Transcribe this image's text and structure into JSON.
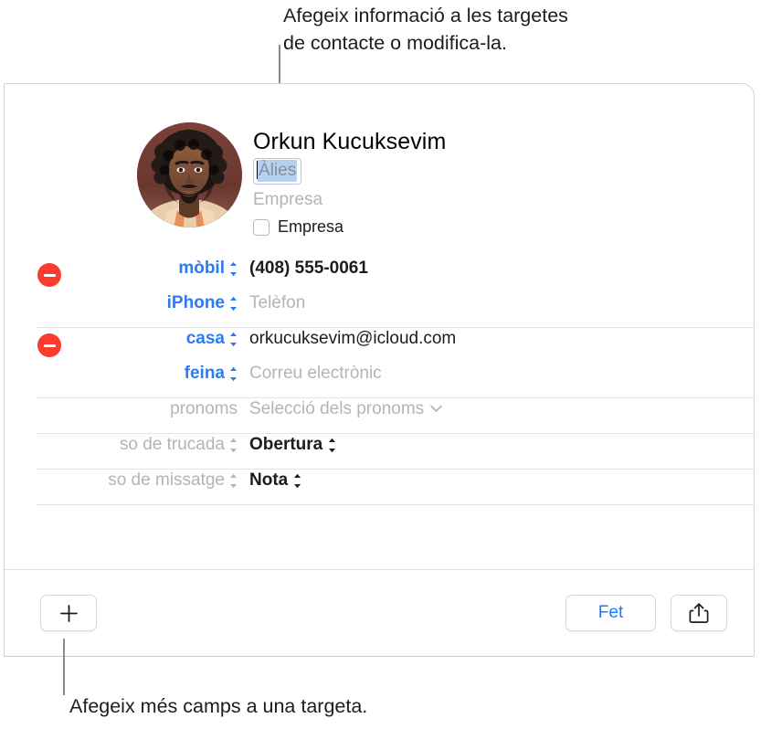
{
  "callouts": {
    "top": {
      "line1": "Afegeix informació a les targetes",
      "line2": "de contacte o modifica-la."
    },
    "bottom": {
      "line1": "Afegeix més camps a una targeta."
    }
  },
  "card": {
    "header": {
      "full_name": "Orkun  Kucuksevim",
      "nickname_value": "Àlies",
      "company_placeholder": "Empresa",
      "company_checkbox_label": "Empresa",
      "company_checkbox_checked": false
    },
    "fields": [
      {
        "label": "mòbil",
        "label_style": "blue",
        "value": "(408) 555-0061",
        "value_style": "bold",
        "has_remove": true,
        "has_stepper": true
      },
      {
        "label": "iPhone",
        "label_style": "blue",
        "value": "Telèfon",
        "value_style": "placeholder",
        "has_remove": false,
        "has_stepper": true
      },
      {
        "label": "casa",
        "label_style": "blue",
        "value": "orkucuksevim@icloud.com",
        "value_style": "normal",
        "has_remove": true,
        "has_stepper": true
      },
      {
        "label": "feina",
        "label_style": "blue",
        "value": "Correu electrònic",
        "value_style": "placeholder",
        "has_remove": false,
        "has_stepper": true
      },
      {
        "label": "pronoms",
        "label_style": "gray",
        "value": "Selecció dels pronoms",
        "value_style": "placeholder",
        "has_remove": false,
        "has_chevron": true
      },
      {
        "label": "so de trucada",
        "label_style": "gray",
        "value": "Obertura",
        "value_style": "strong",
        "has_remove": false,
        "has_stepper": true
      },
      {
        "label": "so de missatge",
        "label_style": "gray",
        "value": "Nota",
        "value_style": "strong",
        "has_remove": false,
        "has_stepper": true
      }
    ],
    "footer": {
      "add_label": "+",
      "done_label": "Fet",
      "share_label": "share-icon"
    }
  },
  "colors": {
    "accent_blue": "#1a7cfb",
    "label_blue": "#2b7bf3",
    "remove_red": "#fc3b30",
    "placeholder_gray": "#b4b4b8",
    "selection_blue": "#b3d2f2",
    "separator": "#e4e4e6"
  }
}
